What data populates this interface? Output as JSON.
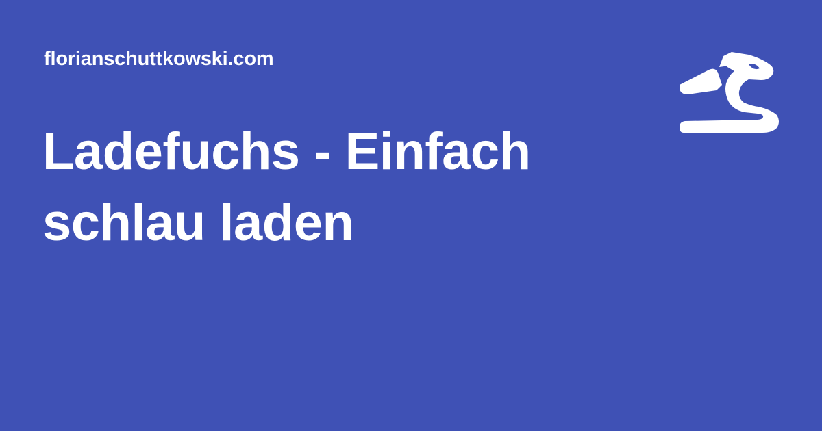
{
  "card": {
    "site": "florianschuttkowski.com",
    "title_line_1": "Ladefuchs - Einfach",
    "title_line_2": "schlau laden",
    "logo_icon": "dragon-icon",
    "background_color": "#3f51b5",
    "text_color": "#ffffff"
  }
}
